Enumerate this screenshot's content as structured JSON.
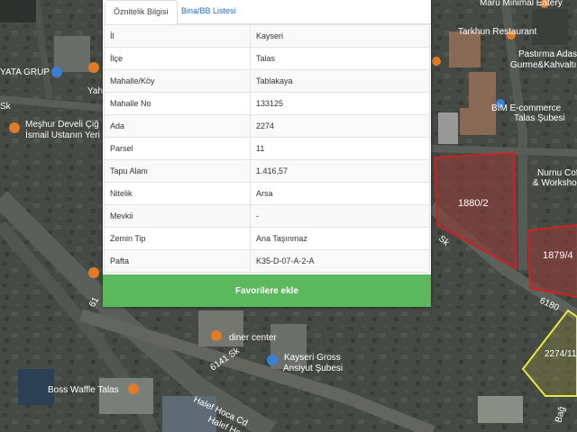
{
  "tabs": [
    {
      "label": "Öznitelik Bilgisi"
    },
    {
      "label": "Bina/BB Listesi"
    }
  ],
  "attributes": [
    {
      "key": "İl",
      "value": "Kayseri"
    },
    {
      "key": "İlçe",
      "value": "Talas"
    },
    {
      "key": "Mahalle/Köy",
      "value": "Tablakaya"
    },
    {
      "key": "Mahalle No",
      "value": "133125"
    },
    {
      "key": "Ada",
      "value": "2274"
    },
    {
      "key": "Parsel",
      "value": "11"
    },
    {
      "key": "Tapu Alanı",
      "value": "1.416,57"
    },
    {
      "key": "Nitelik",
      "value": "Arsa"
    },
    {
      "key": "Mevkii",
      "value": "-"
    },
    {
      "key": "Zemin Tip",
      "value": "Ana Taşınmaz"
    },
    {
      "key": "Pafta",
      "value": "K35-D-07-A-2-A"
    }
  ],
  "favorite_button": "Favorilere ekle",
  "map": {
    "labels": {
      "ata_grup": "YATA GRUP",
      "mesihur": "Meşhur Develi Çiğ",
      "ismail": "İsmail Ustanın Yeri",
      "yah": "Yah",
      "sk_left": "Sk",
      "maru": "Maru Minimal Eatery",
      "tarkhun": "Tarkhun Restaurant",
      "pastirma": "Pastırma Adası",
      "gurme": "Gurme&Kahvaltı",
      "bim": "BİM E-commerce",
      "talas_subesi": "Talas Şubesi",
      "nurnu": "Nurnu Coffee",
      "workshop": "& Workshop",
      "sk_right": "Sk",
      "s6180": "6180",
      "s6141": "6141 Sk",
      "s61": "61",
      "diner": "diner center",
      "kayseri_gross": "Kayseri Gross",
      "ansiyut": "Ansiyut Şubesi",
      "boss": "Boss Waffle Talas",
      "halef1": "Halef Hoca Cd",
      "halef2": "Halef Hoca Cd",
      "parcel1": "1880/2",
      "parcel2": "1879/4",
      "parcel3": "2274/11",
      "bag": "Bağ"
    }
  }
}
